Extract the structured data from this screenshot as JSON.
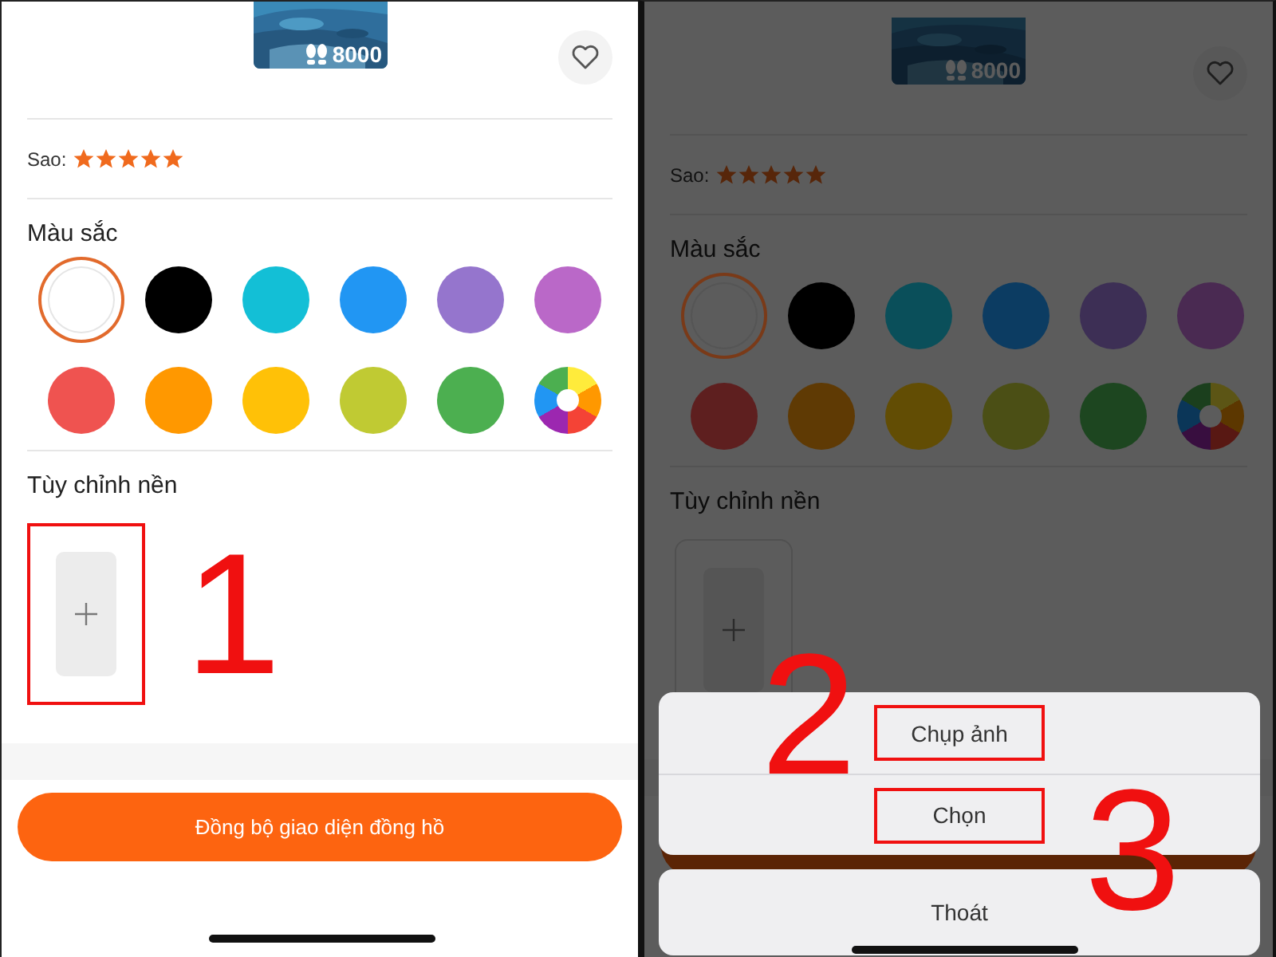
{
  "panels": [
    {
      "dimmed": false,
      "photo_badge": "8000",
      "stars_label": "Sao:",
      "stars": 5,
      "colors_title": "Màu sắc",
      "swatches": [
        {
          "kind": "solid",
          "color": "#ffffff",
          "selected": true
        },
        {
          "kind": "solid",
          "color": "#000000",
          "selected": false
        },
        {
          "kind": "solid",
          "color": "#13bfd6",
          "selected": false
        },
        {
          "kind": "solid",
          "color": "#2196f3",
          "selected": false
        },
        {
          "kind": "solid",
          "color": "#9575cd",
          "selected": false
        },
        {
          "kind": "solid",
          "color": "#ba68c8",
          "selected": false
        },
        {
          "kind": "solid",
          "color": "#ef5350",
          "selected": false
        },
        {
          "kind": "solid",
          "color": "#ff9800",
          "selected": false
        },
        {
          "kind": "solid",
          "color": "#ffc107",
          "selected": false
        },
        {
          "kind": "solid",
          "color": "#c0ca33",
          "selected": false
        },
        {
          "kind": "solid",
          "color": "#4caf50",
          "selected": false
        },
        {
          "kind": "wheel",
          "selected": false
        }
      ],
      "custom_title": "Tùy chỉnh nền",
      "tile_highlighted": true,
      "tile_step": "1",
      "sync_button": "Đồng bộ giao diện đồng hồ"
    },
    {
      "dimmed": true,
      "photo_badge": "8000",
      "stars_label": "Sao:",
      "stars": 5,
      "colors_title": "Màu sắc",
      "swatches": [
        {
          "kind": "solid",
          "color": "#5c5c5c",
          "selected": true
        },
        {
          "kind": "solid",
          "color": "#000000",
          "selected": false
        },
        {
          "kind": "solid",
          "color": "#0a4f5a",
          "selected": false
        },
        {
          "kind": "solid",
          "color": "#0c3c62",
          "selected": false
        },
        {
          "kind": "solid",
          "color": "#3d2f55",
          "selected": false
        },
        {
          "kind": "solid",
          "color": "#4a2a52",
          "selected": false
        },
        {
          "kind": "solid",
          "color": "#5e1f1f",
          "selected": false
        },
        {
          "kind": "solid",
          "color": "#5f3a04",
          "selected": false
        },
        {
          "kind": "solid",
          "color": "#624d04",
          "selected": false
        },
        {
          "kind": "solid",
          "color": "#4b4f15",
          "selected": false
        },
        {
          "kind": "solid",
          "color": "#1d4620",
          "selected": false
        },
        {
          "kind": "wheel",
          "selected": false
        }
      ],
      "custom_title": "Tùy chỉnh nền",
      "tile_highlighted": false,
      "action_sheet": {
        "actions": [
          {
            "label": "Chụp ảnh",
            "highlighted": true
          },
          {
            "label": "Chọn",
            "highlighted": true
          }
        ],
        "cancel": "Thoát"
      },
      "steps": [
        {
          "label": "2"
        },
        {
          "label": "3"
        }
      ]
    }
  ]
}
